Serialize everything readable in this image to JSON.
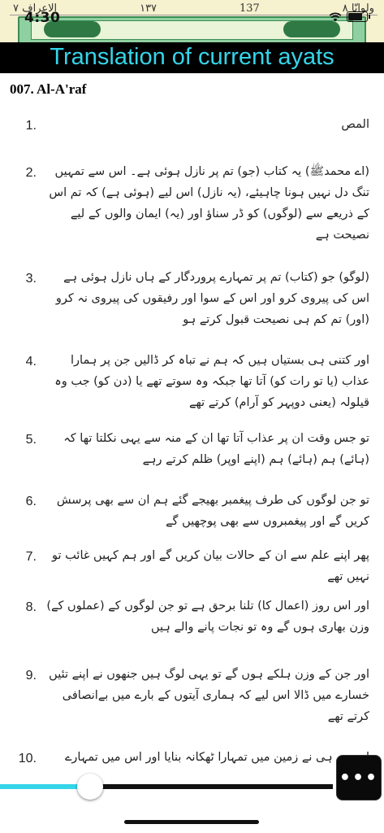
{
  "status_bar": {
    "time": "4:30"
  },
  "quran_page": {
    "surah_label": "الاعراف ٧",
    "para_label": "ولوانّا ٨",
    "page_number": "137",
    "juz_marker": "۱۳۷"
  },
  "header": {
    "title": "Translation of current ayats"
  },
  "surah": {
    "name": "007. Al-A'raf"
  },
  "ayats": [
    {
      "number": "1.",
      "text": "المص"
    },
    {
      "number": "2.",
      "text": "(اے محمدﷺ) یہ کتاب (جو) تم پر نازل ہوئی ہے۔ اس سے تمہیں تنگ دل نہیں ہونا چاہیئے، (یہ نازل) اس لیے (ہوئی ہے) کہ تم اس کے ذریعے سے (لوگوں) کو ڈر سناؤ اور (یہ) ایمان والوں کے لیے نصیحت ہے"
    },
    {
      "number": "3.",
      "text": "(لوگو) جو (کتاب) تم پر تمہارے پروردگار کے ہاں نازل ہوئی ہے اس کی پیروی کرو اور اس کے سوا اور رفیقوں کی پیروی نہ کرو (اور) تم کم ہی نصیحت قبول کرتے ہو"
    },
    {
      "number": "4.",
      "text": "اور کتنی ہی بستیاں ہیں کہ ہم نے تباہ کر ڈالیں جن پر ہمارا عذاب (یا تو رات کو) آتا تھا جبکہ وہ سوتے تھے یا (دن کو) جب وہ قیلولہ (یعنی دوپہر کو آرام) کرتے تھے"
    },
    {
      "number": "5.",
      "text": "تو جس وقت ان پر عذاب آتا تھا ان کے منہ سے یہی نکلتا تھا کہ (ہائے) ہم (ہائے) ہم (اپنے اوپر) ظلم کرتے رہے"
    },
    {
      "number": "6.",
      "text": "تو جن لوگوں کی طرف پیغمبر بھیجے گئے ہم ان سے بھی پرسش کریں گے اور پیغمبروں سے بھی پوچھیں گے"
    },
    {
      "number": "7.",
      "text": "پھر اپنے علم سے ان کے حالات بیان کریں گے اور ہم کہیں غائب تو نہیں تھے"
    },
    {
      "number": "8.",
      "text": "اور اس روز (اعمال کا) تلنا برحق ہے تو جن لوگوں کے (عملوں کے) وزن بھاری ہوں گے وہ تو نجات پانے والے ہیں"
    },
    {
      "number": "9.",
      "text": "اور جن کے وزن ہلکے ہوں گے تو یہی لوگ ہیں جنھوں نے اپنے تئیں خسارے میں ڈالا اس لیے کہ ہماری آیتوں کے بارے میں بےانصافی کرتے تھے"
    },
    {
      "number": "10.",
      "text": "اور ہم ہی نے زمین میں تمہارا ٹھکانہ بنایا اور اس میں تمہارے"
    }
  ],
  "player": {
    "progress": 0.27
  },
  "menu": {
    "more_label": "•••"
  },
  "colors": {
    "accent": "#35d5e9",
    "title_bg": "#000000"
  }
}
